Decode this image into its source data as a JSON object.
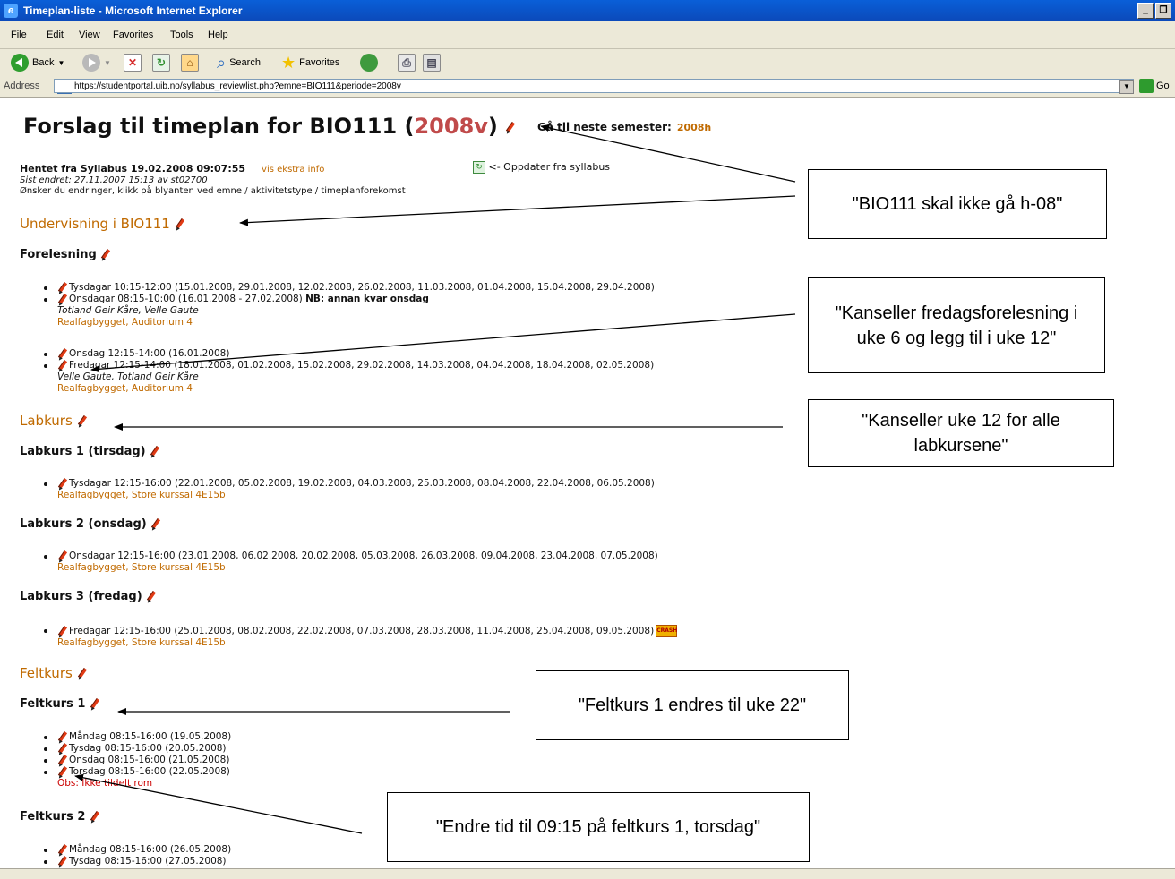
{
  "window": {
    "title": "Timeplan-liste - Microsoft Internet Explorer"
  },
  "menu": [
    "File",
    "Edit",
    "View",
    "Favorites",
    "Tools",
    "Help"
  ],
  "toolbar": {
    "back": "Back",
    "search": "Search",
    "favorites": "Favorites"
  },
  "address": {
    "label": "Address",
    "url": "https://studentportal.uib.no/syllabus_reviewlist.php?emne=BIO111&periode=2008v",
    "go": "Go"
  },
  "page": {
    "title_prefix": "Forslag til timeplan for BIO111 (",
    "period": "2008v",
    "title_suffix": ")",
    "next_label": "Gå til neste semester:",
    "next_link": "2008h",
    "fetched": "Hentet fra Syllabus 19.02.2008 09:07:55",
    "extra_info": "vis ekstra info",
    "changed": "Sist endret: 27.11.2007 15:13 av st02700",
    "wish": "Ønsker du endringer, klikk på blyanten ved emne / aktivitetstype / timeplanforekomst",
    "update": "<- Oppdater fra syllabus"
  },
  "sections": {
    "undervisning": "Undervisning i BIO111",
    "forelesning": "Forelesning",
    "labkurs": "Labkurs",
    "lab1": "Labkurs 1 (tirsdag)",
    "lab2": "Labkurs 2 (onsdag)",
    "lab3": "Labkurs 3 (fredag)",
    "feltkurs": "Feltkurs",
    "felt1": "Feltkurs 1",
    "felt2": "Feltkurs 2"
  },
  "forelesning": {
    "tue": "Tysdagar 10:15-12:00 (15.01.2008, 29.01.2008, 12.02.2008, 26.02.2008, 11.03.2008, 01.04.2008, 15.04.2008, 29.04.2008)",
    "wed": "Onsdagar 08:15-10:00 (16.01.2008 - 27.02.2008)",
    "wed_nb": "NB: annan kvar onsdag",
    "teachers1": "Totland Geir Kåre, Velle Gaute",
    "room1": "Realfagbygget, Auditorium 4",
    "wed2": "Onsdag 12:15-14:00 (16.01.2008)",
    "fri": "Fredagar 12:15-14:00 (18.01.2008, 01.02.2008, 15.02.2008, 29.02.2008, 14.03.2008, 04.04.2008, 18.04.2008, 02.05.2008)",
    "teachers2": "Velle Gaute, Totland Geir Kåre",
    "room2": "Realfagbygget, Auditorium 4"
  },
  "lab": {
    "l1": "Tysdagar 12:15-16:00 (22.01.2008, 05.02.2008, 19.02.2008, 04.03.2008, 25.03.2008, 08.04.2008, 22.04.2008, 06.05.2008)",
    "l1_room": "Realfagbygget, Store kurssal 4E15b",
    "l2": "Onsdagar 12:15-16:00 (23.01.2008, 06.02.2008, 20.02.2008, 05.03.2008, 26.03.2008, 09.04.2008, 23.04.2008, 07.05.2008)",
    "l2_room": "Realfagbygget, Store kurssal 4E15b",
    "l3": "Fredagar 12:15-16:00 (25.01.2008, 08.02.2008, 22.02.2008, 07.03.2008, 28.03.2008, 11.04.2008, 25.04.2008, 09.05.2008)",
    "l3_room": "Realfagbygget, Store kurssal 4E15b",
    "crash": "CRASH"
  },
  "felt": {
    "f1_mon": "Måndag 08:15-16:00 (19.05.2008)",
    "f1_tue": "Tysdag 08:15-16:00 (20.05.2008)",
    "f1_wed": "Onsdag 08:15-16:00 (21.05.2008)",
    "f1_thu": "Torsdag 08:15-16:00 (22.05.2008)",
    "f1_obs": "Obs: Ikke tildelt rom",
    "f2_mon": "Måndag 08:15-16:00 (26.05.2008)",
    "f2_tue": "Tysdag 08:15-16:00 (27.05.2008)"
  },
  "annotations": {
    "a1": "\"BIO111 skal ikke gå h-08\"",
    "a2": "\"Kanseller fredagsforelesning i uke 6 og legg til i uke 12\"",
    "a3": "\"Kanseller uke 12 for alle labkursene\"",
    "a4": "\"Feltkurs 1 endres til uke 22\"",
    "a5": "\"Endre tid til 09:15 på feltkurs 1, torsdag\""
  }
}
